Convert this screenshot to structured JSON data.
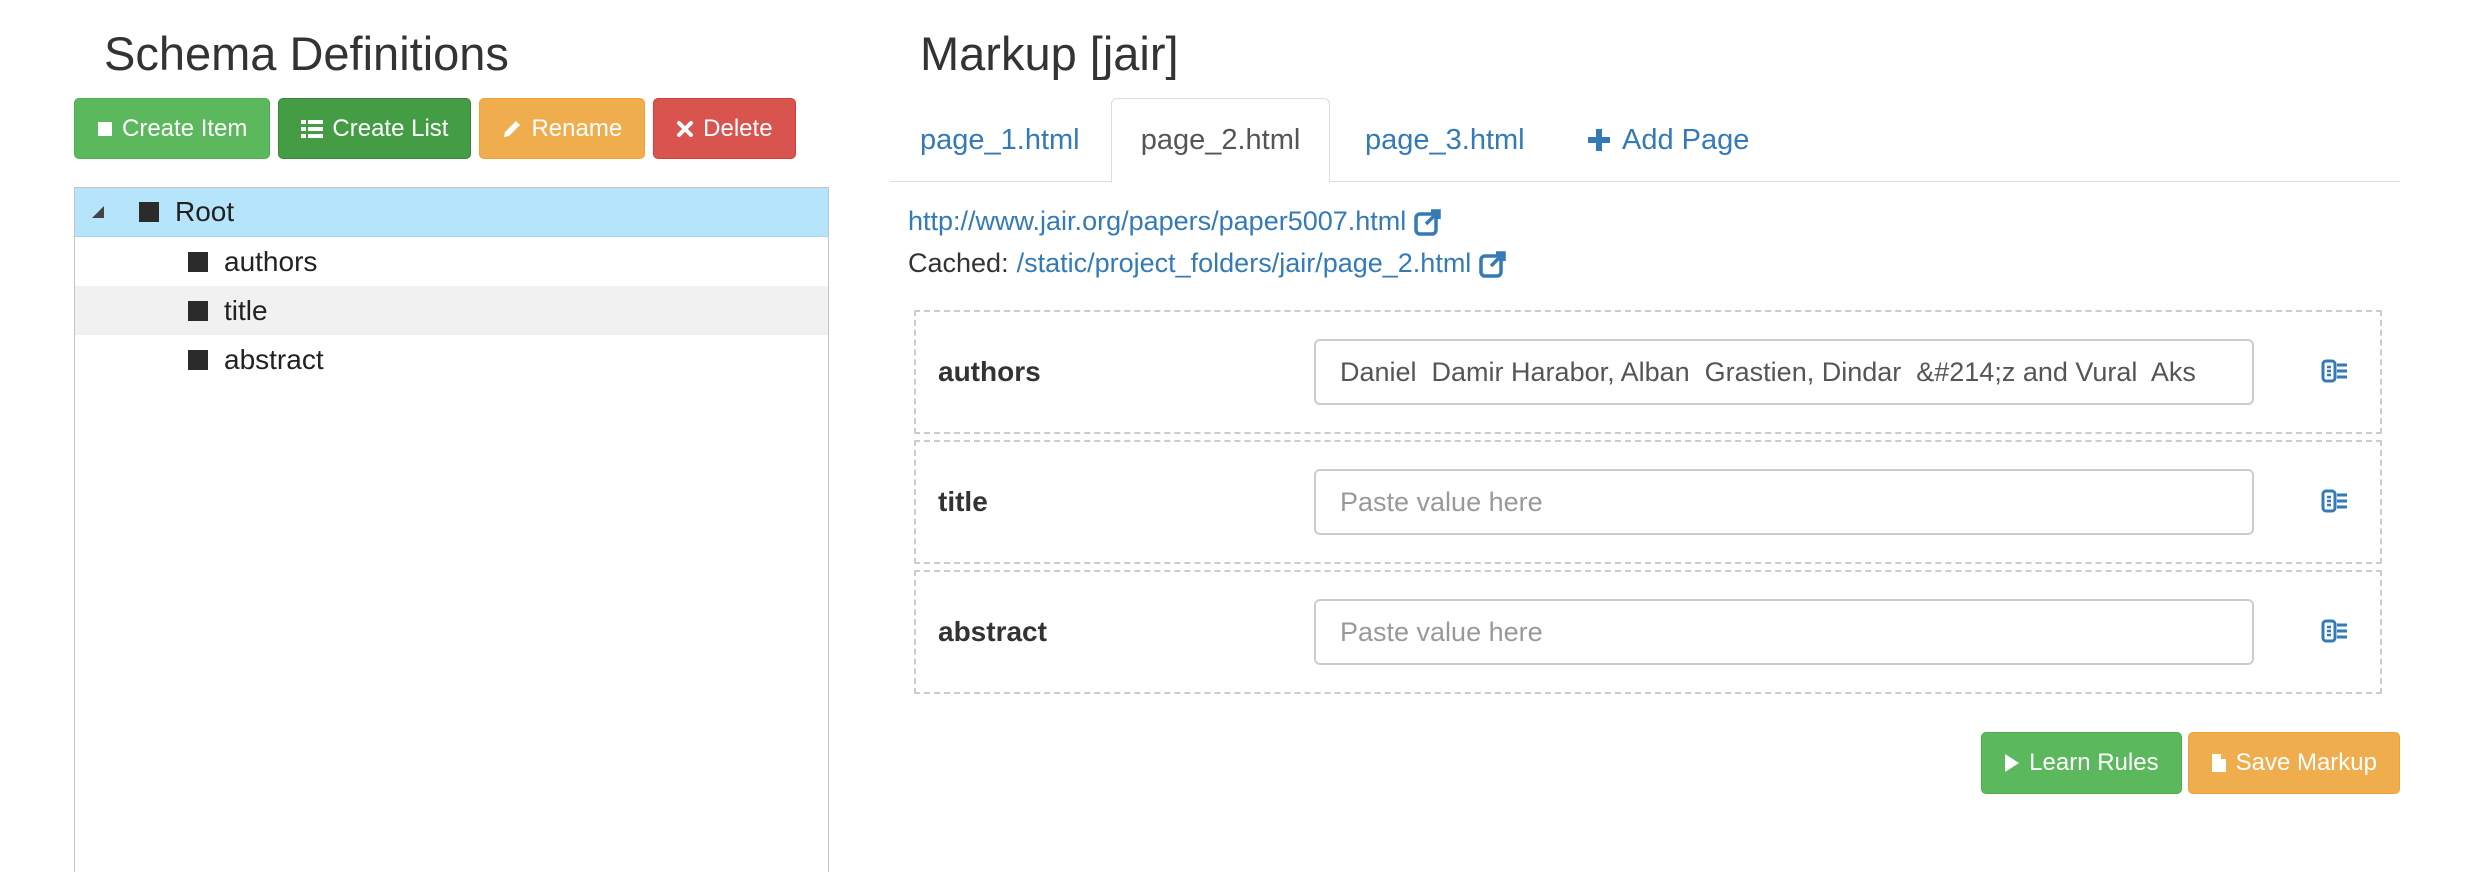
{
  "schema": {
    "title": "Schema Definitions",
    "toolbar": {
      "create_item": "Create Item",
      "create_list": "Create List",
      "rename": "Rename",
      "delete": "Delete"
    },
    "tree": {
      "root": "Root",
      "children": [
        "authors",
        "title",
        "abstract"
      ],
      "selected": "Root"
    }
  },
  "markup": {
    "title": "Markup [jair]",
    "tabs": [
      "page_1.html",
      "page_2.html",
      "page_3.html"
    ],
    "active_tab": "page_2.html",
    "add_page": "Add Page",
    "source_url": "http://www.jair.org/papers/paper5007.html",
    "cached_label": "Cached:",
    "cached_url": "/static/project_folders/jair/page_2.html",
    "fields": [
      {
        "label": "authors",
        "value": "Daniel  Damir Harabor, Alban  Grastien, Dindar  &#214;z and Vural  Aks",
        "placeholder": "Paste value here"
      },
      {
        "label": "title",
        "value": "",
        "placeholder": "Paste value here"
      },
      {
        "label": "abstract",
        "value": "",
        "placeholder": "Paste value here"
      }
    ],
    "learn_rules": "Learn Rules",
    "save_markup": "Save Markup"
  },
  "colors": {
    "success": "#5cb85c",
    "success_dark": "#449d44",
    "warning": "#f0ad4e",
    "danger": "#d9534f",
    "link": "#337ab7",
    "tree_selected": "#b6e4fb"
  },
  "icons": [
    "stop-square-icon",
    "list-icon",
    "pencil-icon",
    "remove-icon",
    "plus-icon",
    "external-link-icon",
    "extract-icon",
    "play-icon",
    "file-icon"
  ]
}
